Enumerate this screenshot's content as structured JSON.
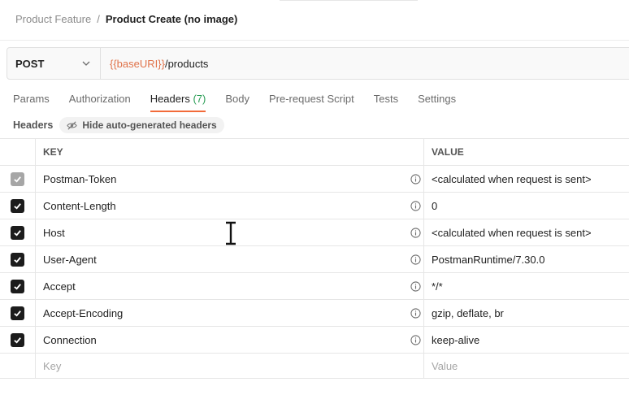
{
  "breadcrumb": {
    "parent": "Product Feature",
    "separator": "/",
    "current": "Product Create (no image)"
  },
  "request": {
    "method": "POST",
    "url_variable": "{{baseURI}}",
    "url_path": "/products"
  },
  "tabs": [
    {
      "label": "Params"
    },
    {
      "label": "Authorization"
    },
    {
      "label": "Headers",
      "count": "(7)",
      "active": true
    },
    {
      "label": "Body"
    },
    {
      "label": "Pre-request Script"
    },
    {
      "label": "Tests"
    },
    {
      "label": "Settings"
    }
  ],
  "headers_section": {
    "title": "Headers",
    "hide_button": "Hide auto-generated headers"
  },
  "table": {
    "columns": {
      "key": "KEY",
      "value": "VALUE"
    },
    "rows": [
      {
        "key": "Postman-Token",
        "value": "<calculated when request is sent>",
        "checked": true,
        "disabled": true
      },
      {
        "key": "Content-Length",
        "value": "0",
        "checked": true
      },
      {
        "key": "Host",
        "value": "<calculated when request is sent>",
        "checked": true
      },
      {
        "key": "User-Agent",
        "value": "PostmanRuntime/7.30.0",
        "checked": true
      },
      {
        "key": "Accept",
        "value": "*/*",
        "checked": true
      },
      {
        "key": "Accept-Encoding",
        "value": "gzip, deflate, br",
        "checked": true
      },
      {
        "key": "Connection",
        "value": "keep-alive",
        "checked": true
      }
    ],
    "new_row": {
      "key_placeholder": "Key",
      "value_placeholder": "Value"
    }
  },
  "colors": {
    "accent": "#f26b3a",
    "variable": "#e0734a",
    "count": "#2a9d55"
  },
  "icons": {
    "method_dropdown": "chevron-down-icon",
    "hide_button": "eye-off-icon",
    "row_info": "info-icon",
    "cursor": "text-cursor-icon"
  }
}
